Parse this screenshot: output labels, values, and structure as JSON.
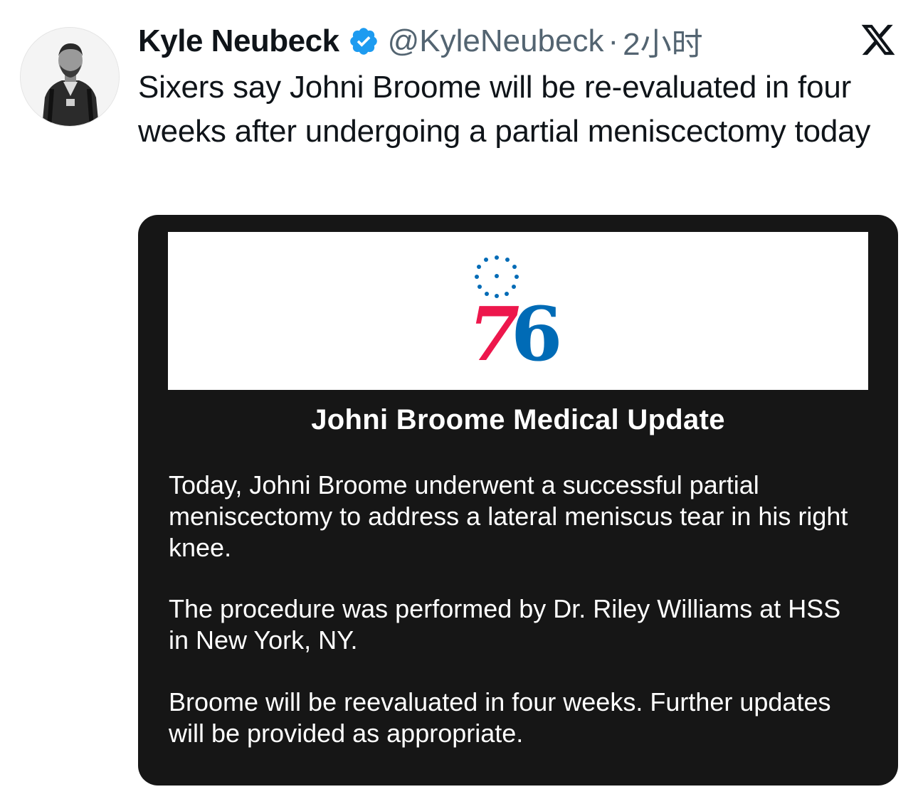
{
  "tweet": {
    "author_name": "Kyle Neubeck",
    "handle": "@KyleNeubeck",
    "separator": "·",
    "time": "2小时",
    "text": "Sixers say Johni Broome will be re-evaluated in four weeks after undergoing a partial meniscectomy today",
    "icons": {
      "verified": "verified-badge-icon",
      "platform": "x-logo-icon",
      "avatar": "profile-photo"
    },
    "colors": {
      "verified_blue": "#1d9bf0",
      "text": "#0f1419",
      "muted": "#536471"
    }
  },
  "media": {
    "logo_text": "76",
    "logo_colors": {
      "seven": "#ed174c",
      "six": "#006bb6",
      "stars": "#006bb6"
    },
    "title": "Johni Broome Medical Update",
    "paragraphs": [
      "Today, Johni Broome underwent a successful partial meniscectomy to address a lateral meniscus tear in his right knee.",
      "The procedure was performed by Dr. Riley Williams at HSS in New York, NY.",
      "Broome will be reevaluated in four weeks. Further updates will be provided as appropriate."
    ],
    "background": "#161616"
  }
}
